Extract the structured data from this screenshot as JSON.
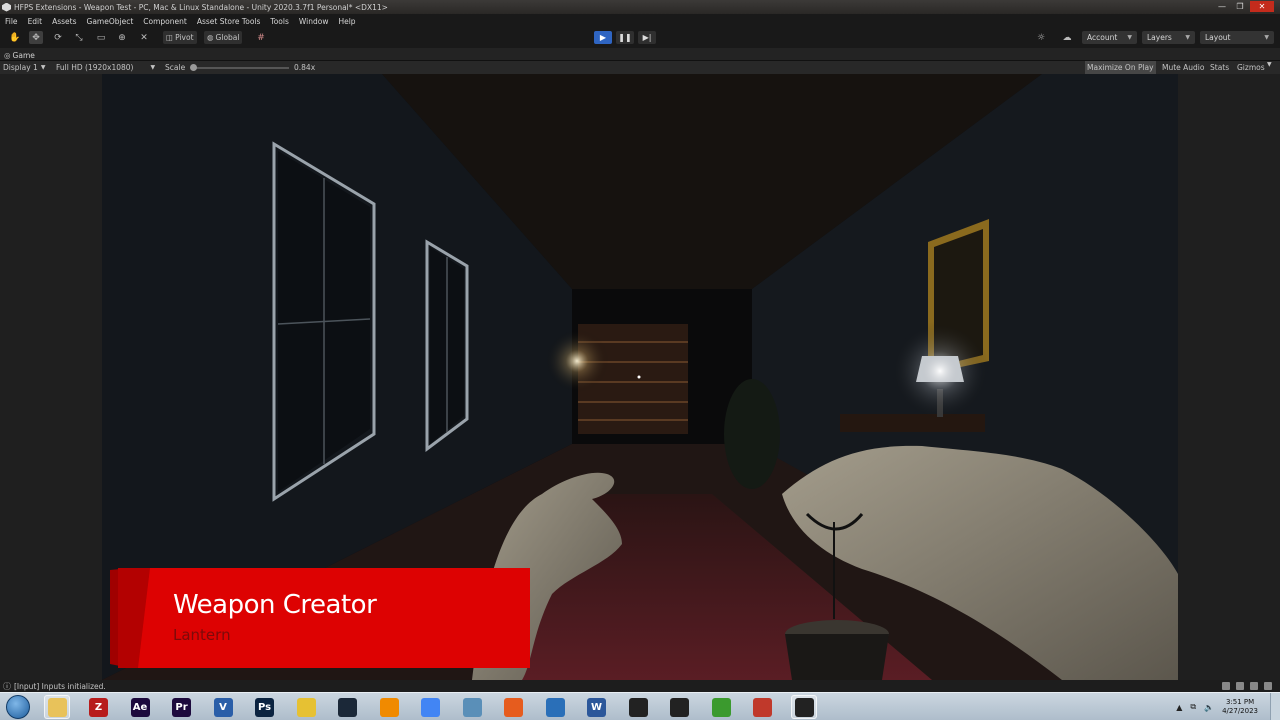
{
  "window": {
    "title": "HFPS Extensions - Weapon Test - PC, Mac & Linux Standalone - Unity 2020.3.7f1 Personal* <DX11>",
    "controls": [
      "—",
      "❐",
      "✕"
    ]
  },
  "menu": [
    "File",
    "Edit",
    "Assets",
    "GameObject",
    "Component",
    "Asset Store Tools",
    "Tools",
    "Window",
    "Help"
  ],
  "toolbar": {
    "tools": [
      "hand-tool-icon",
      "move-tool-icon",
      "rotate-tool-icon",
      "scale-tool-icon",
      "rect-tool-icon",
      "transform-tool-icon",
      "custom-tool-icon"
    ],
    "pivot_label": "Pivot",
    "global_label": "Global",
    "account_label": "Account",
    "layers_label": "Layers",
    "layout_label": "Layout"
  },
  "game_tab": {
    "label": "Game",
    "display": "Display 1",
    "resolution": "Full HD (1920x1080)",
    "scale_label": "Scale",
    "scale_value": "0.84x",
    "maximize_on_play": "Maximize On Play",
    "mute_audio": "Mute Audio",
    "stats": "Stats",
    "gizmos": "Gizmos"
  },
  "overlay": {
    "title": "Weapon Creator",
    "subtitle": "Lantern",
    "accent": "#e00000"
  },
  "status": {
    "message": "[Input] Inputs initialized."
  },
  "taskbar": {
    "apps": [
      {
        "name": "file-explorer",
        "glyph": "",
        "color": "#e8c25a"
      },
      {
        "name": "filezilla",
        "glyph": "Z",
        "color": "#b71c1c"
      },
      {
        "name": "after-effects",
        "glyph": "Ae",
        "color": "#1d0a3d"
      },
      {
        "name": "premiere-pro",
        "glyph": "Pr",
        "color": "#1d0a3d"
      },
      {
        "name": "visual-studio",
        "glyph": "V",
        "color": "#2a5ea8"
      },
      {
        "name": "photoshop",
        "glyph": "Ps",
        "color": "#0b2340"
      },
      {
        "name": "python",
        "glyph": "",
        "color": "#e6c133"
      },
      {
        "name": "steam",
        "glyph": "",
        "color": "#1b2838"
      },
      {
        "name": "vlc",
        "glyph": "",
        "color": "#f08a00"
      },
      {
        "name": "chrome",
        "glyph": "",
        "color": "#4285f4"
      },
      {
        "name": "app-crystal",
        "glyph": "",
        "color": "#5a8fb8"
      },
      {
        "name": "firefox",
        "glyph": "",
        "color": "#e65c1e"
      },
      {
        "name": "app-frame",
        "glyph": "",
        "color": "#2a6fb8"
      },
      {
        "name": "word",
        "glyph": "W",
        "color": "#2b579a"
      },
      {
        "name": "unity",
        "glyph": "",
        "color": "#222"
      },
      {
        "name": "unity-hub",
        "glyph": "",
        "color": "#222"
      },
      {
        "name": "utorrent",
        "glyph": "",
        "color": "#3b9a2e"
      },
      {
        "name": "app-game",
        "glyph": "",
        "color": "#c0392b"
      },
      {
        "name": "unity-editor",
        "glyph": "",
        "color": "#222"
      }
    ],
    "time": "3:51 PM",
    "date": "4/27/2023"
  }
}
